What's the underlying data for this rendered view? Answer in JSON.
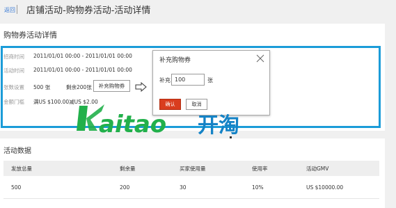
{
  "header": {
    "back_label": "返回",
    "title": "店铺活动-购物券活动-活动详情"
  },
  "details": {
    "title": "购物券活动详情",
    "rows": [
      {
        "label": "招商时间",
        "value": "2011/01/01 00:00 - 2011/01/01 00:00"
      },
      {
        "label": "活动时间",
        "value": "2011/01/01 00:00 - 2011/01/01 00:00"
      },
      {
        "label": "张数设置",
        "value": "500 张"
      },
      {
        "label": "金额门槛",
        "value": "满US $100.00减US $2.00"
      }
    ],
    "remaining_text": "剩余200张",
    "topup_button": "补充购物券"
  },
  "dialog": {
    "title": "补充购物券",
    "field_label": "补充",
    "field_value": "100",
    "unit": "张",
    "confirm_label": "确认",
    "cancel_label": "取消"
  },
  "watermark": {
    "latin": "kaitao",
    "cjk": "开淘",
    "colors": {
      "green": "#22b04b",
      "blue": "#1583c6"
    }
  },
  "stats": {
    "title": "活动数据",
    "columns": [
      "发放总量",
      "剩余量",
      "买家使用量",
      "使用率",
      "活动GMV"
    ],
    "row": [
      "500",
      "200",
      "30",
      "10%",
      "US $10000.00"
    ]
  },
  "colors": {
    "highlight_border": "#1b9cd8",
    "confirm_bg": "#d93d1e",
    "link": "#3a7bd5"
  }
}
